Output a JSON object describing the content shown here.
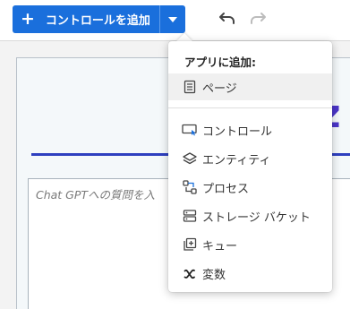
{
  "toolbar": {
    "add_control_label": "コントロールを追加",
    "plus_glyph": "+"
  },
  "canvas": {
    "big_letter": "z",
    "chat_placeholder": "Chat GPTへの質問を入"
  },
  "menu": {
    "heading": "アプリに追加:",
    "items": [
      {
        "label": "ページ",
        "icon": "page-icon",
        "highlighted": true
      },
      {
        "label": "コントロール",
        "icon": "control-icon"
      },
      {
        "label": "エンティティ",
        "icon": "layers-icon"
      },
      {
        "label": "プロセス",
        "icon": "process-icon"
      },
      {
        "label": "ストレージ バケット",
        "icon": "storage-icon"
      },
      {
        "label": "キュー",
        "icon": "queue-icon"
      },
      {
        "label": "変数",
        "icon": "variable-icon"
      }
    ]
  },
  "colors": {
    "primary": "#1a6fdc",
    "accent_purple": "#4b35c9",
    "rule_blue": "#2e3fbf"
  }
}
